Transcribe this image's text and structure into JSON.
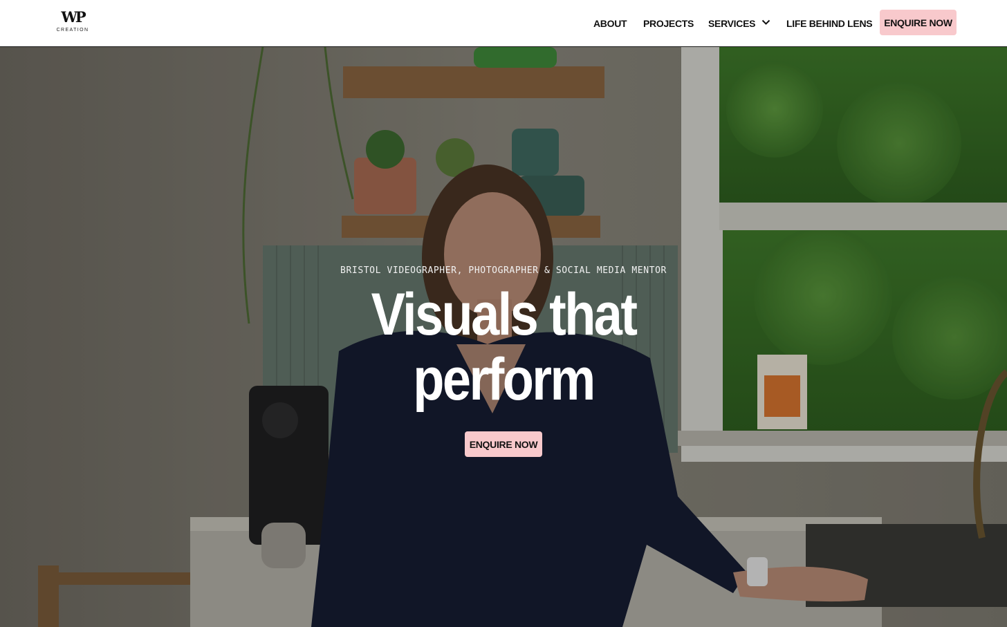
{
  "logo": {
    "mark": "WP",
    "wordmark": "CREATION"
  },
  "nav": {
    "items": [
      {
        "label": "ABOUT"
      },
      {
        "label": "PROJECTS"
      },
      {
        "label": "SERVICES",
        "icon": "chevron-down-icon"
      },
      {
        "label": "LIFE BEHIND LENS"
      }
    ],
    "cta_label": "ENQUIRE NOW"
  },
  "hero": {
    "eyebrow": "BRISTOL VIDEOGRAPHER, PHOTOGRAPHER & SOCIAL MEDIA MENTOR",
    "headline_line1": "Visuals that",
    "headline_line2": "perform",
    "cta_label": "ENQUIRE NOW"
  },
  "colors": {
    "accent": "#f8c9cc",
    "header_bg": "#ffffff",
    "text_dark": "#111111",
    "hero_text": "#ffffff"
  }
}
